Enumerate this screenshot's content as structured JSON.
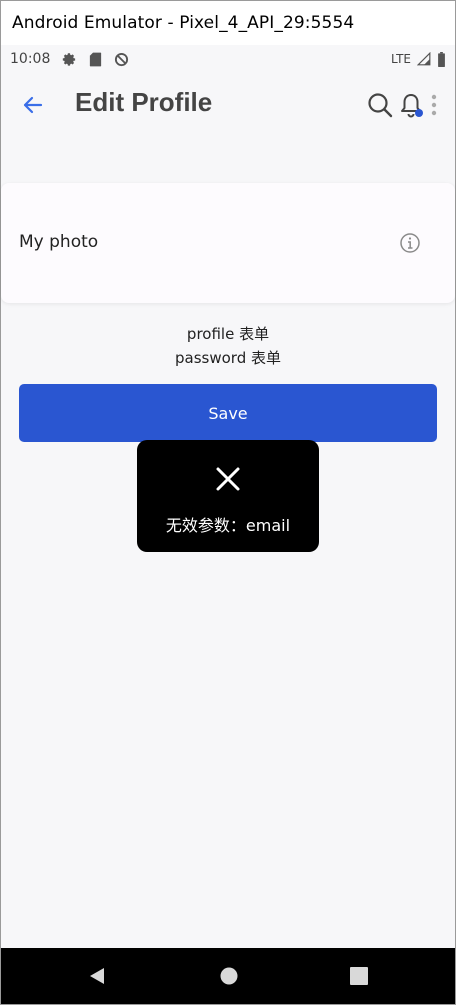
{
  "window": {
    "title": "Android Emulator - Pixel_4_API_29:5554"
  },
  "status_bar": {
    "time": "10:08",
    "network": "LTE",
    "left_icons": [
      "gear-icon",
      "sd-card-icon",
      "data-saver-icon"
    ],
    "right_icons": [
      "signal-icon",
      "battery-icon"
    ]
  },
  "app_bar": {
    "title": "Edit Profile",
    "back_icon": "arrow-left-icon",
    "actions": [
      "search-icon",
      "bell-icon",
      "more-vert-icon"
    ],
    "accent_color": "#2a56d1"
  },
  "photo_card": {
    "label": "My photo",
    "icon": "info-icon"
  },
  "forms": {
    "profile": "profile 表单",
    "password": "password 表单"
  },
  "save_button": {
    "label": "Save",
    "color": "#2a56d1"
  },
  "toast": {
    "icon": "close-icon",
    "message": "无效参数：email"
  },
  "nav_bar": {
    "buttons": [
      "nav-back-icon",
      "nav-home-icon",
      "nav-recent-icon"
    ]
  }
}
